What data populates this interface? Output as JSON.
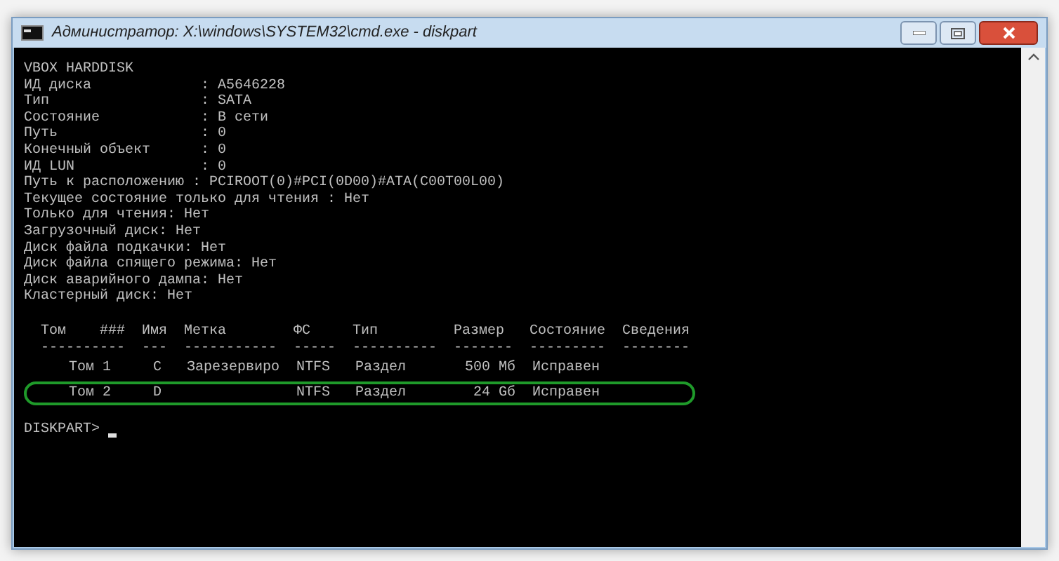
{
  "window": {
    "title": "Администратор: X:\\windows\\SYSTEM32\\cmd.exe - diskpart"
  },
  "console": {
    "lines": [
      "VBOX HARDDISK",
      "ИД диска             : A5646228",
      "Тип                  : SATA",
      "Состояние            : В сети",
      "Путь                 : 0",
      "Конечный объект      : 0",
      "ИД LUN               : 0",
      "Путь к расположению : PCIROOT(0)#PCI(0D00)#ATA(C00T00L00)",
      "Текущее состояние только для чтения : Нет",
      "Только для чтения: Нет",
      "Загрузочный диск: Нет",
      "Диск файла подкачки: Нет",
      "Диск файла спящего режима: Нет",
      "Диск аварийного дампа: Нет",
      "Кластерный диск: Нет"
    ]
  },
  "table": {
    "columns": [
      {
        "label": "Том",
        "label_2": "###",
        "rule": "----------"
      },
      {
        "label": "Имя",
        "rule": "---"
      },
      {
        "label": "Метка",
        "rule": "-----------"
      },
      {
        "label": "ФС",
        "rule": "-----"
      },
      {
        "label": "Тип",
        "rule": "----------"
      },
      {
        "label": "Размер",
        "rule": "-------"
      },
      {
        "label": "Состояние",
        "rule": "---------"
      },
      {
        "label": "Сведения",
        "rule": "--------"
      }
    ],
    "rows": [
      {
        "selected": false,
        "cells": [
          "Том 1",
          "C",
          "Зарезервиро",
          "NTFS",
          "Раздел",
          "500 Мб",
          "Исправен",
          ""
        ]
      },
      {
        "selected": true,
        "cells": [
          "Том 2",
          "D",
          "",
          "NTFS",
          "Раздел",
          "24 Gб",
          "Исправен",
          ""
        ]
      }
    ]
  },
  "prompt": "DISKPART>"
}
